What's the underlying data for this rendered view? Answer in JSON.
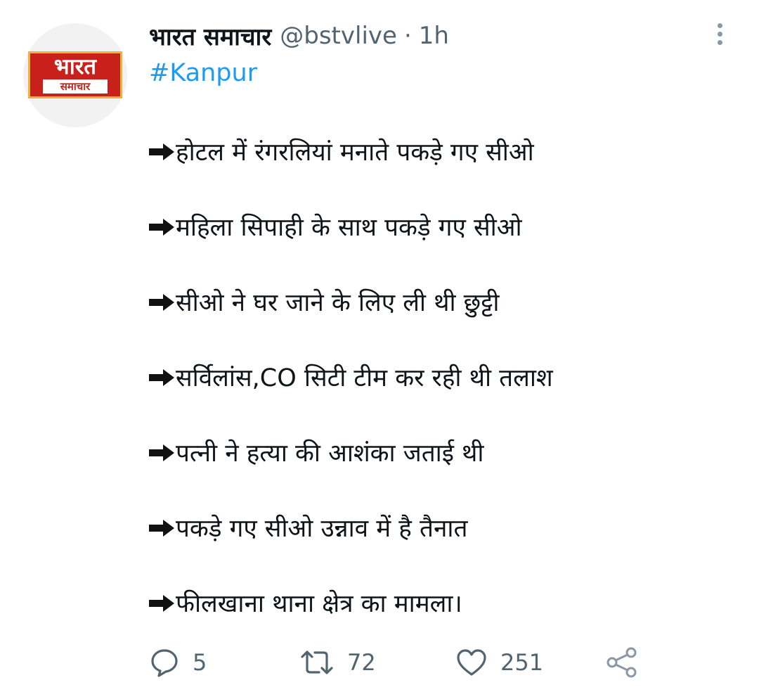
{
  "tweet": {
    "author": {
      "display_name": "भारत समाचार",
      "handle": "@bstvlive",
      "separator": "·",
      "time": "1h",
      "avatar_logo": {
        "main": "भारत",
        "sub": "समाचार"
      }
    },
    "hashtag": "#Kanpur",
    "lines": [
      "होटल में रंगरलियां मनाते पकड़े गए सीओ",
      "महिला सिपाही के साथ पकड़े गए सीओ",
      "सीओ ने घर जाने के लिए ली थी छुट्टी",
      "सर्विलांस,CO सिटी टीम कर रही थी तलाश",
      "पत्नी ने हत्या की आशंका जताई थी",
      "पकड़े गए सीओ उन्नाव में है तैनात",
      "फीलखाना थाना क्षेत्र का मामला।"
    ],
    "line_prefix_icon": "right-arrow-emoji",
    "actions": {
      "reply_count": "5",
      "retweet_count": "72",
      "like_count": "251"
    },
    "colors": {
      "link": "#1d9bf0",
      "secondary_text": "#536471",
      "logo_red": "#c8201b",
      "logo_border": "#e8b43c"
    }
  }
}
